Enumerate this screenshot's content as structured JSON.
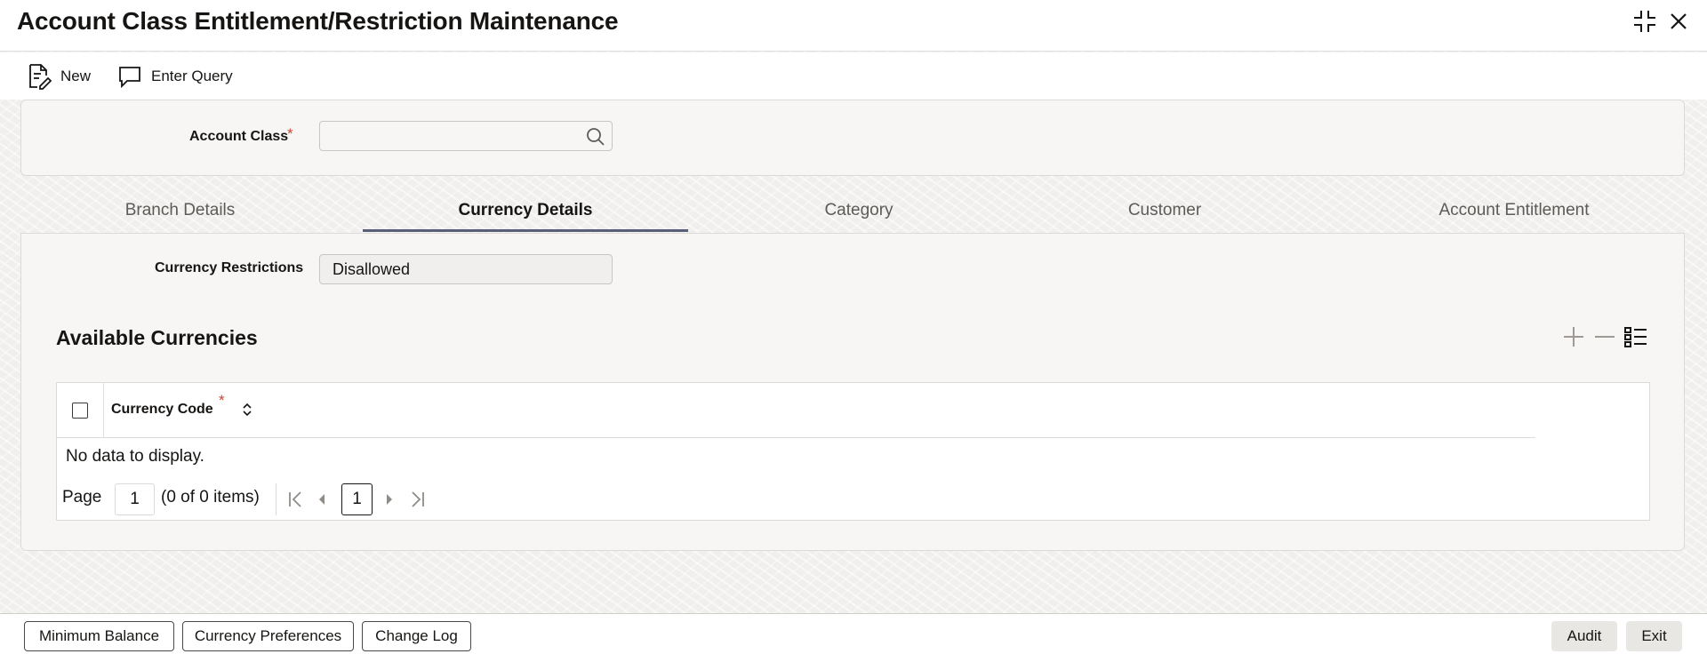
{
  "window": {
    "title": "Account Class Entitlement/Restriction Maintenance"
  },
  "toolbar": {
    "new_label": "New",
    "enter_query_label": "Enter Query"
  },
  "header_form": {
    "account_class_label": "Account Class",
    "account_class_value": "",
    "required_marker": "*"
  },
  "tabs": [
    {
      "label": "Branch Details",
      "active": false
    },
    {
      "label": "Currency Details",
      "active": true
    },
    {
      "label": "Category",
      "active": false
    },
    {
      "label": "Customer",
      "active": false
    },
    {
      "label": "Account Entitlement",
      "active": false
    }
  ],
  "currency_details": {
    "restrictions_label": "Currency Restrictions",
    "restrictions_value": "Disallowed",
    "section_title": "Available Currencies",
    "table": {
      "columns": [
        {
          "label": "Currency Code",
          "required": true,
          "sortable": true
        }
      ],
      "rows": [],
      "empty_message": "No data to display.",
      "pagination": {
        "page_label": "Page",
        "page_value": "1",
        "items_text": "(0 of 0 items)",
        "current_page": "1"
      }
    }
  },
  "footer": {
    "buttons": {
      "minimum_balance": "Minimum Balance",
      "currency_preferences": "Currency Preferences",
      "change_log": "Change Log",
      "audit": "Audit",
      "exit": "Exit"
    }
  },
  "icons": {
    "accent_color": "#5a5f78",
    "required_color": "#c74634"
  }
}
